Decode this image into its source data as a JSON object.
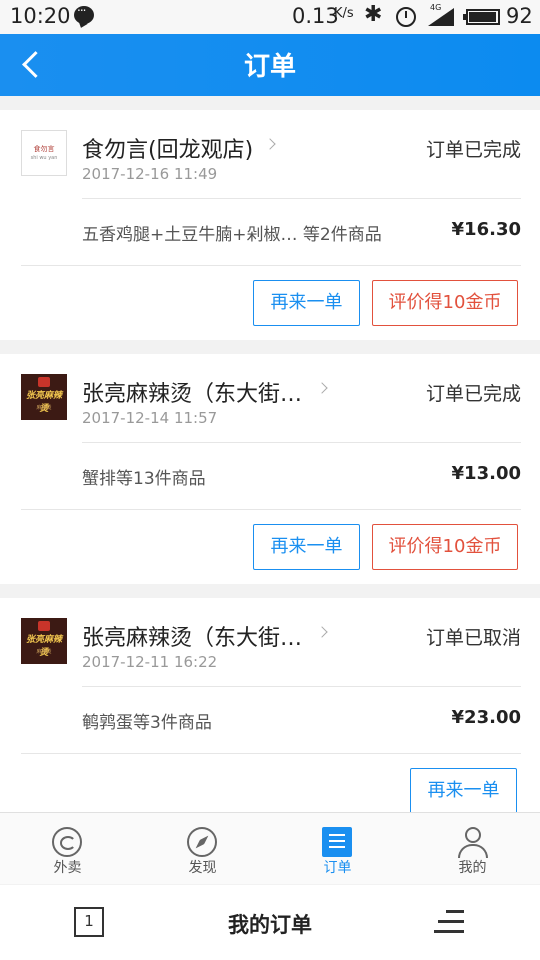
{
  "status_bar": {
    "time": "10:20",
    "network_speed": "0.13",
    "speed_unit": "K/s",
    "signal_label": "4G",
    "battery": "92"
  },
  "header": {
    "title": "订单"
  },
  "orders": [
    {
      "shop_name": "食勿言(回龙观店)",
      "logo_text": "食勿言",
      "logo_sub": "shi wu yan",
      "status": "订单已完成",
      "date": "2017-12-16 11:49",
      "items": "五香鸡腿+土豆牛腩+剁椒…  等2件商品",
      "price": "¥16.30",
      "reorder_label": "再来一单",
      "review_label": "评价得10金币"
    },
    {
      "shop_name": "张亮麻辣烫（东大街…",
      "logo_text": "张亮麻辣烫",
      "status": "订单已完成",
      "date": "2017-12-14 11:57",
      "items": "蟹排等13件商品",
      "price": "¥13.00",
      "reorder_label": "再来一单",
      "review_label": "评价得10金币"
    },
    {
      "shop_name": "张亮麻辣烫（东大街…",
      "logo_text": "张亮麻辣烫",
      "status": "订单已取消",
      "date": "2017-12-11 16:22",
      "items": "鹌鹑蛋等3件商品",
      "price": "¥23.00",
      "reorder_label": "再来一单"
    }
  ],
  "tabs": [
    {
      "label": "外卖",
      "icon": "takeout-icon"
    },
    {
      "label": "发现",
      "icon": "compass-icon"
    },
    {
      "label": "订单",
      "icon": "order-list-icon",
      "active": true
    },
    {
      "label": "我的",
      "icon": "person-icon"
    }
  ],
  "nav_bar": {
    "title": "我的订单",
    "square_number": "1"
  },
  "colors": {
    "accent": "#1a8ff0",
    "review_red": "#e2513d"
  }
}
